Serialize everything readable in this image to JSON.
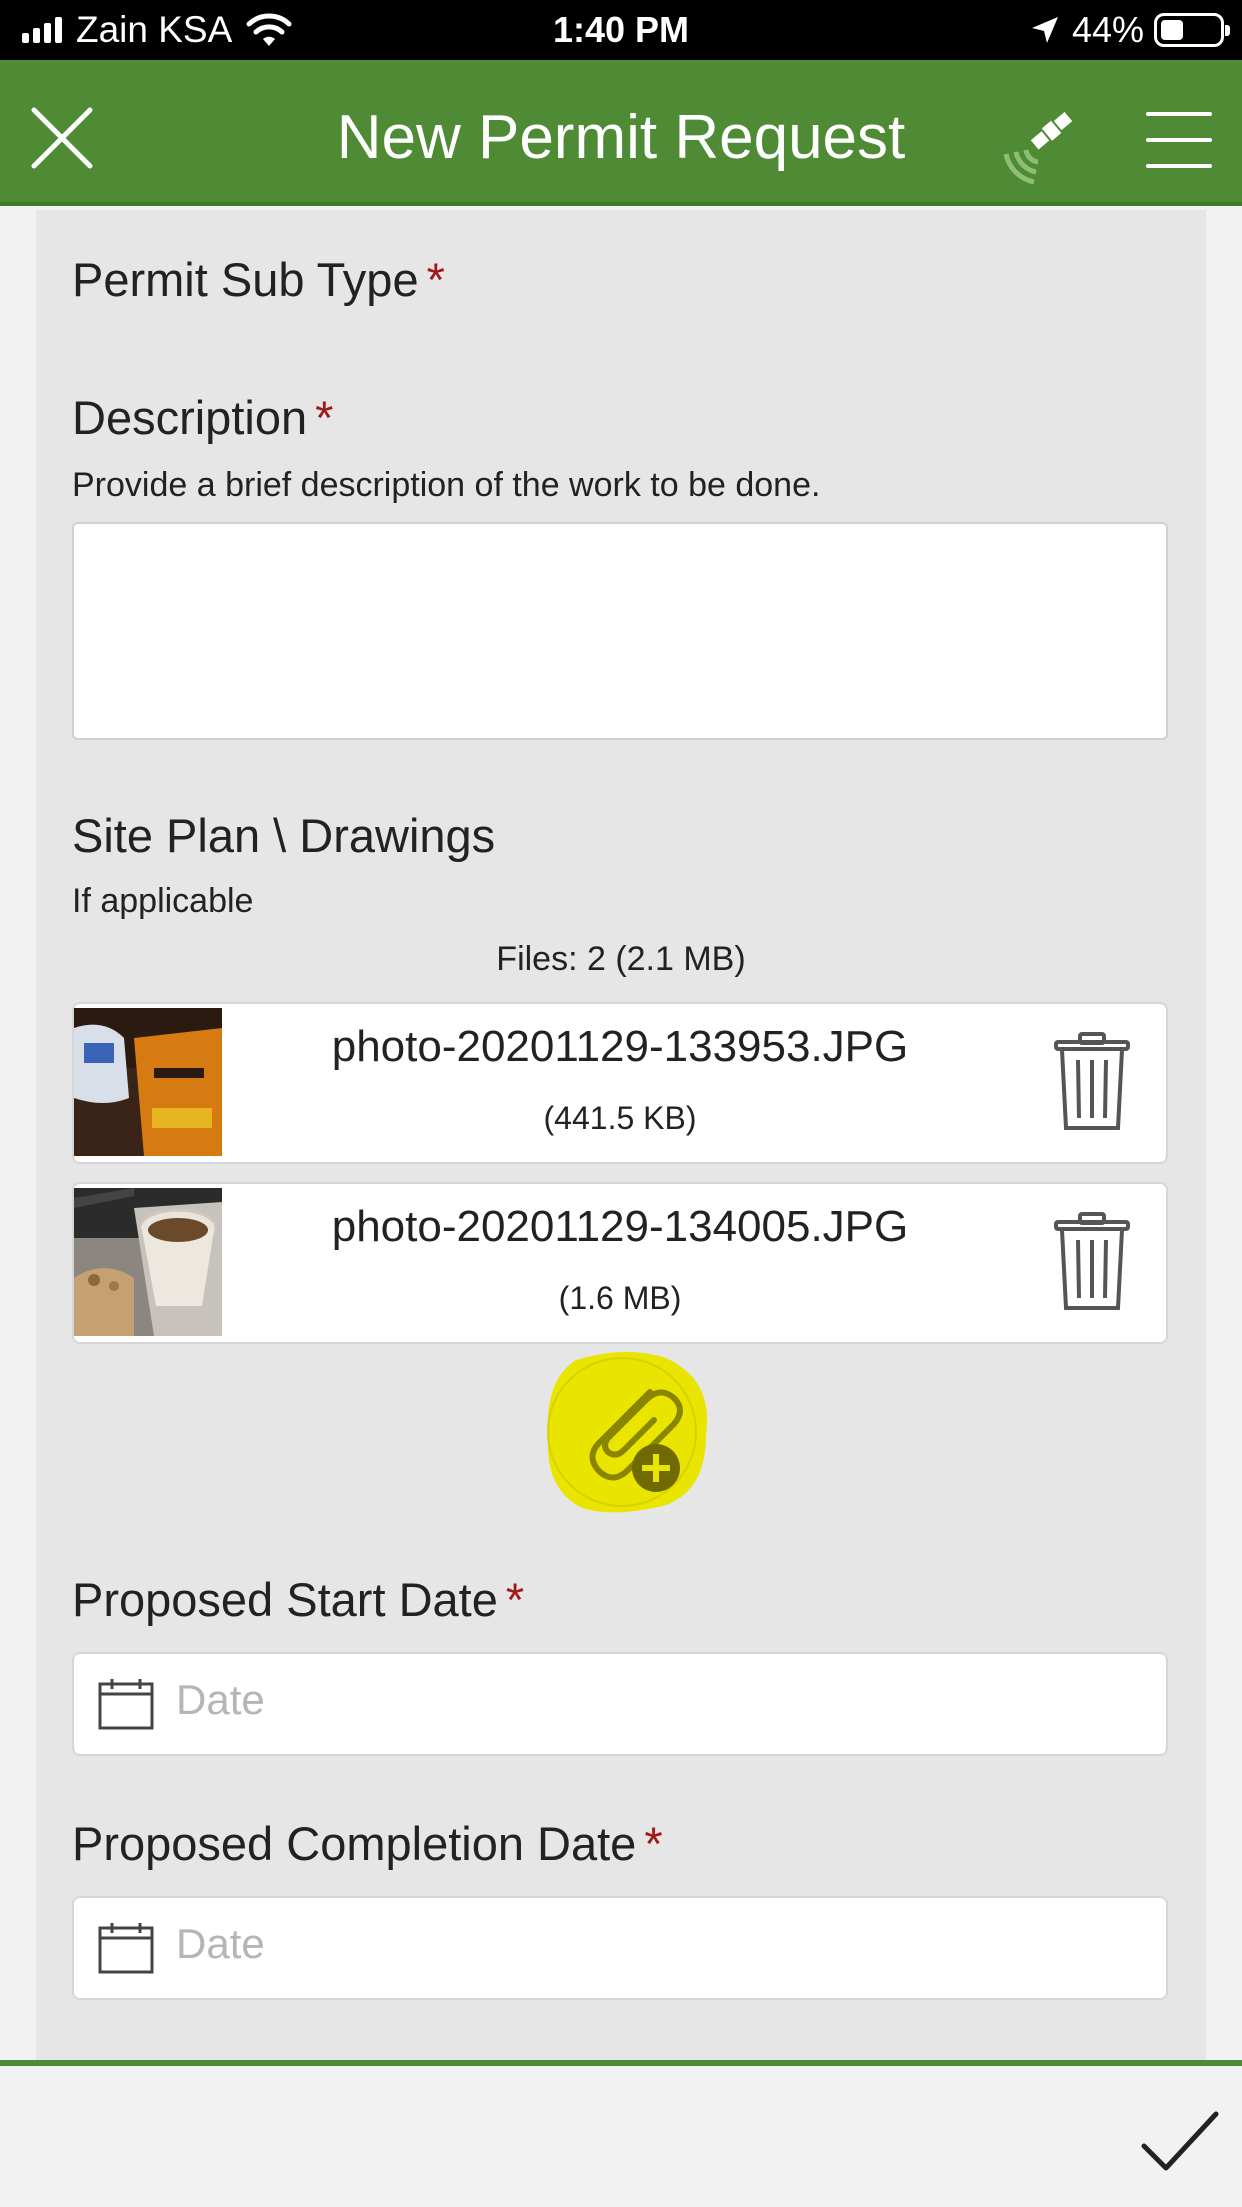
{
  "status_bar": {
    "carrier": "Zain KSA",
    "time": "1:40 PM",
    "battery_percent": "44%",
    "battery_level": 0.44,
    "signal_bars": 4
  },
  "header": {
    "title": "New Permit Request",
    "close_icon": "close-icon",
    "gps_icon": "satellite-gps-icon",
    "menu_icon": "hamburger-menu-icon"
  },
  "form": {
    "permit_sub_type": {
      "label": "Permit Sub Type",
      "required_mark": "*"
    },
    "description": {
      "label": "Description",
      "required_mark": "*",
      "hint": "Provide a brief description of the work to be done.",
      "value": ""
    },
    "site_plan": {
      "label": "Site Plan \\ Drawings",
      "hint": "If applicable",
      "files_summary": "Files: 2 (2.1 MB)",
      "files": [
        {
          "name": "photo-20201129-133953.JPG",
          "size": "(441.5 KB)"
        },
        {
          "name": "photo-20201129-134005.JPG",
          "size": "(1.6 MB)"
        }
      ]
    },
    "start_date": {
      "label": "Proposed Start Date",
      "required_mark": "*",
      "placeholder": "Date"
    },
    "completion_date": {
      "label": "Proposed Completion Date",
      "required_mark": "*",
      "placeholder": "Date"
    }
  },
  "colors": {
    "header_green": "#4f8b35",
    "required_red": "#a01919",
    "highlight_yellow": "#e9e400"
  }
}
